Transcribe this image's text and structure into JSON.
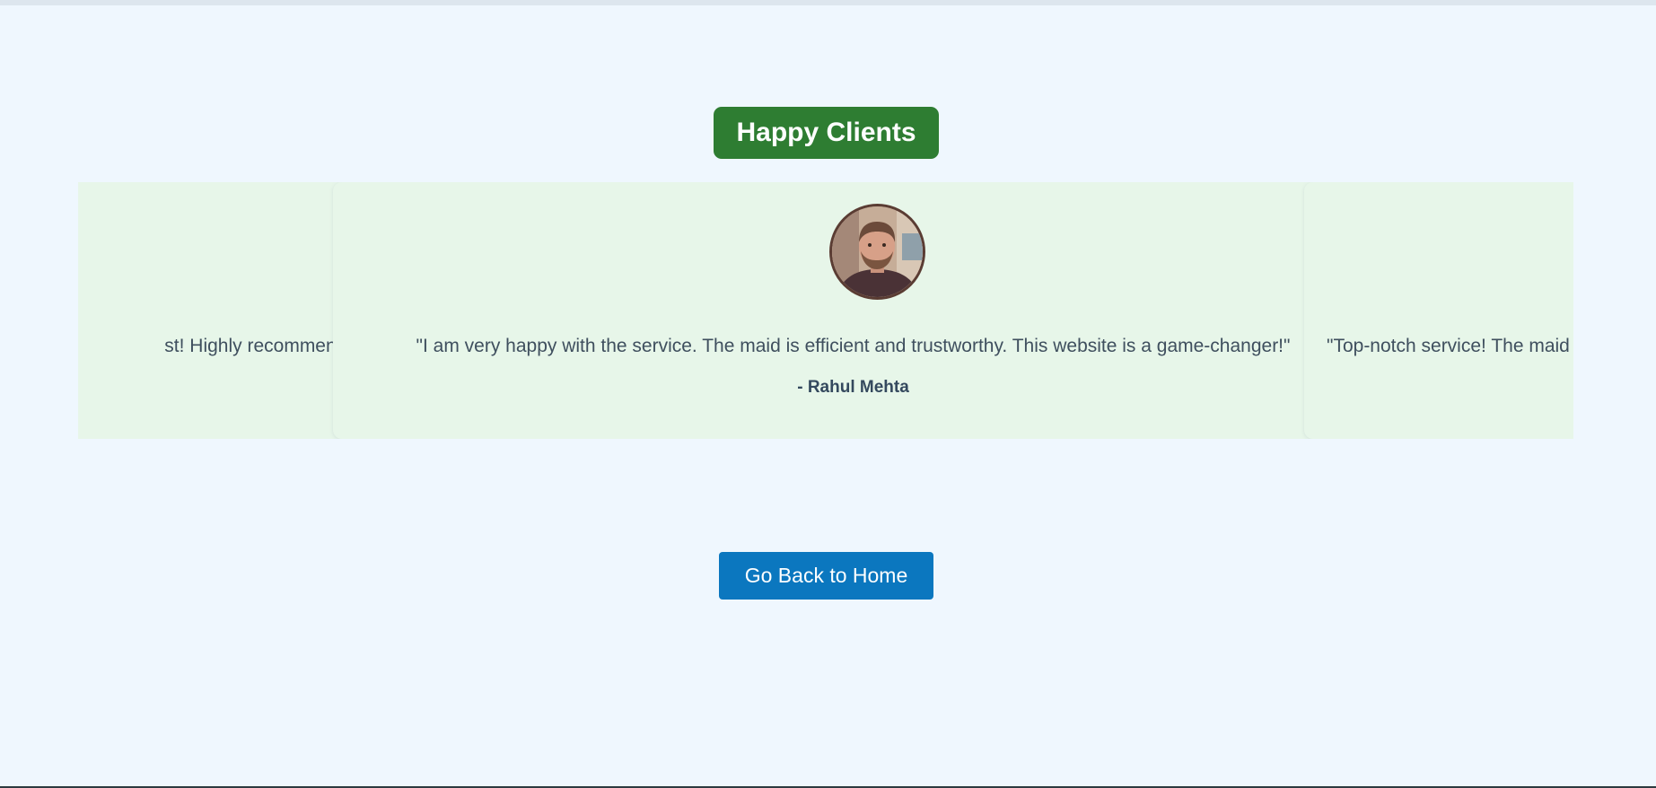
{
  "section": {
    "heading": "Happy Clients"
  },
  "testimonials": [
    {
      "quote": "\"Excellent and trust! Highly recommended.\"",
      "visible_fragment": "st! Highly recommended.\""
    },
    {
      "quote": "\"I am very happy with the service. The maid is efficient and trustworthy. This website is a game-changer!\"",
      "author": "- Rahul Mehta",
      "avatar_icon": "person-avatar"
    },
    {
      "quote": "\"Top-notch service! The maid",
      "visible_fragment": "\"Top-notch service! The maid"
    }
  ],
  "actions": {
    "home_label": "Go Back to Home"
  },
  "colors": {
    "background": "#eff7fe",
    "heading_bg": "#2e7d32",
    "card_bg": "#e7f6e9",
    "button_bg": "#0b77bf",
    "quote_text": "#3f4f5e",
    "author_text": "#34495e"
  }
}
